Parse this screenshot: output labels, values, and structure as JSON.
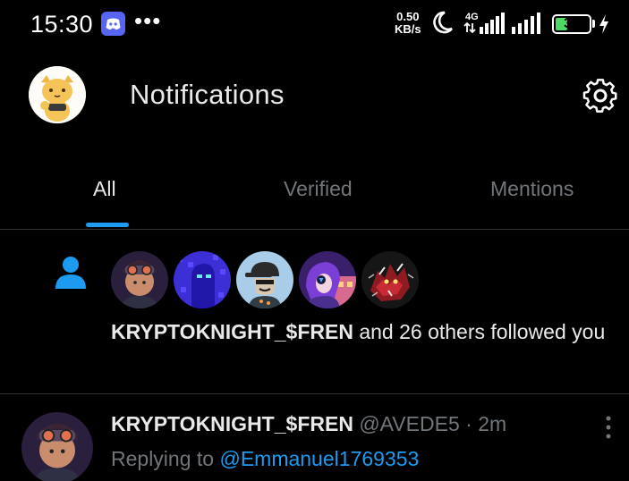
{
  "status_bar": {
    "time": "15:30",
    "speed_value": "0.50",
    "speed_unit": "KB/s",
    "network": "4G",
    "battery": "36",
    "battery_level": 0.36,
    "icons": [
      "discord-icon",
      "more-dots-icon",
      "moon-icon",
      "signal-icon",
      "battery-icon",
      "charging-bolt-icon"
    ]
  },
  "header": {
    "title": "Notifications",
    "settings_icon": "gear-icon"
  },
  "tabs": [
    {
      "label": "All",
      "active": true
    },
    {
      "label": "Verified",
      "active": false
    },
    {
      "label": "Mentions",
      "active": false
    }
  ],
  "follow_notification": {
    "icon": "person-icon",
    "avatar_count": 5,
    "user": "KRYPTOKNIGHT_$FREN",
    "rest": " and 26 others followed you"
  },
  "tweet": {
    "name": "KRYPTOKNIGHT_$FREN",
    "handle": "@AVEDE5",
    "separator": " · ",
    "time": "2m",
    "replying_prefix": "Replying to ",
    "replying_to": "@Emmanuel1769353",
    "more_icon": "more-vertical-icon"
  },
  "colors": {
    "background": "#000000",
    "accent": "#1d9bf0",
    "muted": "#71767b",
    "text": "#e7e9ea",
    "divider": "#2f3336"
  }
}
